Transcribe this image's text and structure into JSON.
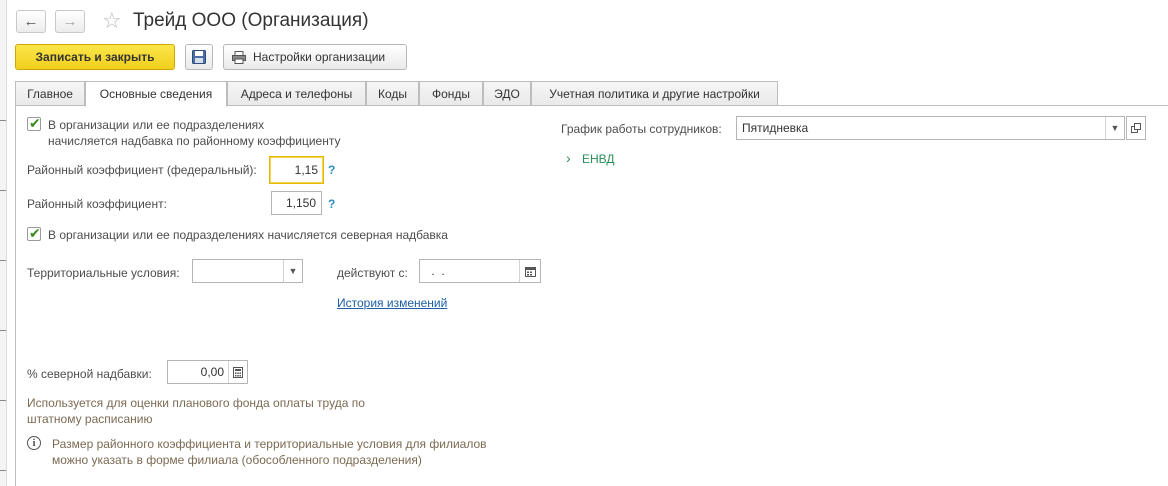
{
  "window": {
    "title": "Трейд ООО (Организация)"
  },
  "nav": {
    "back_icon": "←",
    "forward_icon": "→",
    "favorite_icon": "☆"
  },
  "toolbar": {
    "save_close_label": "Записать и закрыть",
    "org_settings_label": "Настройки организации"
  },
  "tabs": [
    {
      "label": "Главное",
      "active": false
    },
    {
      "label": "Основные сведения",
      "active": true
    },
    {
      "label": "Адреса и телефоны",
      "active": false
    },
    {
      "label": "Коды",
      "active": false
    },
    {
      "label": "Фонды",
      "active": false
    },
    {
      "label": "ЭДО",
      "active": false
    },
    {
      "label": "Учетная политика и другие настройки",
      "active": false
    }
  ],
  "form": {
    "regional_bonus_checkbox": {
      "checked": true,
      "label_line1": "В организации или ее подразделениях",
      "label_line2": "начисляется надбавка по районному коэффициенту"
    },
    "regional_coef_federal": {
      "label": "Районный коэффициент (федеральный):",
      "value": "1,15",
      "help": "?"
    },
    "regional_coef": {
      "label": "Районный коэффициент:",
      "value": "1,150",
      "help": "?"
    },
    "northern_bonus_checkbox": {
      "checked": true,
      "label": "В организации или ее подразделениях начисляется северная надбавка"
    },
    "territorial_conditions": {
      "label": "Территориальные условия:",
      "value": ""
    },
    "effective_from": {
      "label": "действуют с:",
      "value": " .  ."
    },
    "history_link": "История изменений",
    "northern_percent": {
      "label": "% северной надбавки:",
      "value": "0,00"
    },
    "note_planned_fund_line1": "Используется для оценки планового фонда оплаты труда по",
    "note_planned_fund_line2": "штатному расписанию",
    "info_note_line1": "Размер районного коэффициента и территориальные условия для филиалов",
    "info_note_line2": "можно указать в форме филиала (обособленного подразделения)",
    "info_icon": "i"
  },
  "right_panel": {
    "work_schedule": {
      "label": "График работы сотрудников:",
      "value": "Пятидневка"
    },
    "envd_label": "ЕНВД",
    "envd_chevron": "›"
  },
  "colors": {
    "primary_button": "#f5d527",
    "link": "#1b5fa7",
    "help": "#2a8ec1",
    "envd": "#2a8f5a",
    "note": "#7b6a53"
  }
}
